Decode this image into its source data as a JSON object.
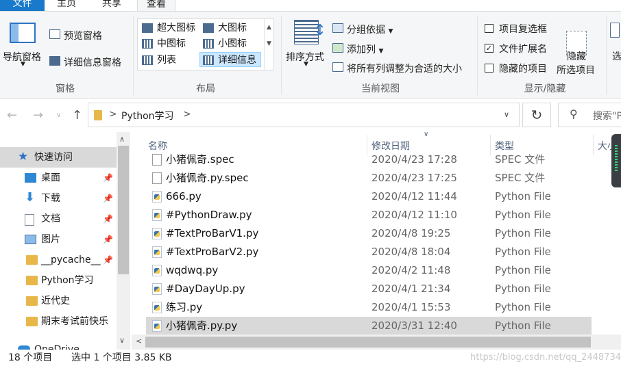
{
  "ribbon_tabs": [
    "文件",
    "主页",
    "共享",
    "查看"
  ],
  "panes_group": {
    "nav_pane": "导航窗格",
    "preview_pane": "预览窗格",
    "details_pane": "详细信息窗格",
    "label": "窗格"
  },
  "layout_group": {
    "items": [
      "超大图标",
      "大图标",
      "中图标",
      "小图标",
      "列表",
      "详细信息"
    ],
    "label": "布局"
  },
  "current_view_group": {
    "sort_by": "排序方式",
    "group_by": "分组依据",
    "add_columns": "添加列",
    "size_all_columns": "将所有列调整为合适的大小",
    "label": "当前视图"
  },
  "show_hide_group": {
    "item_checkboxes": "项目复选框",
    "file_extensions": "文件扩展名",
    "hidden_items": "隐藏的项目",
    "hide_selected_line1": "隐藏",
    "hide_selected_line2": "所选项目",
    "label": "显示/隐藏",
    "options_partial": "选"
  },
  "address": {
    "path_chevron": ">",
    "folder": "Python学习",
    "search_placeholder": "搜索\"P"
  },
  "nav_pane": {
    "quick_access": "快速访问",
    "items": [
      "桌面",
      "下载",
      "文档",
      "图片",
      "__pycache__",
      "Python学习",
      "近代史",
      "期末考试前快乐",
      "OneDrive"
    ]
  },
  "columns": {
    "name": "名称",
    "date": "修改日期",
    "type": "类型",
    "size": "大小"
  },
  "files": [
    {
      "name": "小猪佩奇.spec",
      "date": "2020/4/23 17:28",
      "type": "SPEC 文件",
      "icon": "file-icon"
    },
    {
      "name": "小猪佩奇.py.spec",
      "date": "2020/4/23 17:25",
      "type": "SPEC 文件",
      "icon": "file-icon"
    },
    {
      "name": "666.py",
      "date": "2020/4/12 11:44",
      "type": "Python File",
      "icon": "python-file-icon"
    },
    {
      "name": "#PythonDraw.py",
      "date": "2020/4/12 11:10",
      "type": "Python File",
      "icon": "python-file-icon"
    },
    {
      "name": "#TextProBarV1.py",
      "date": "2020/4/8 19:25",
      "type": "Python File",
      "icon": "python-file-icon"
    },
    {
      "name": "#TextProBarV2.py",
      "date": "2020/4/8 18:04",
      "type": "Python File",
      "icon": "python-file-icon"
    },
    {
      "name": "wqdwq.py",
      "date": "2020/4/2 11:48",
      "type": "Python File",
      "icon": "python-file-icon"
    },
    {
      "name": "#DayDayUp.py",
      "date": "2020/4/1 21:34",
      "type": "Python File",
      "icon": "python-file-icon"
    },
    {
      "name": "练习.py",
      "date": "2020/4/1 15:53",
      "type": "Python File",
      "icon": "python-file-icon"
    },
    {
      "name": "小猪佩奇.py.py",
      "date": "2020/3/31 12:40",
      "type": "Python File",
      "icon": "python-file-icon"
    }
  ],
  "status": {
    "count": "18 个项目",
    "selection": "选中 1 个项目  3.85 KB",
    "watermark": "https://blog.csdn.net/qq_2448734"
  },
  "colors": {
    "file_tab": "#1979ca",
    "selected_row": "#d9d9d9",
    "selected_layout": "#cce8ff"
  }
}
